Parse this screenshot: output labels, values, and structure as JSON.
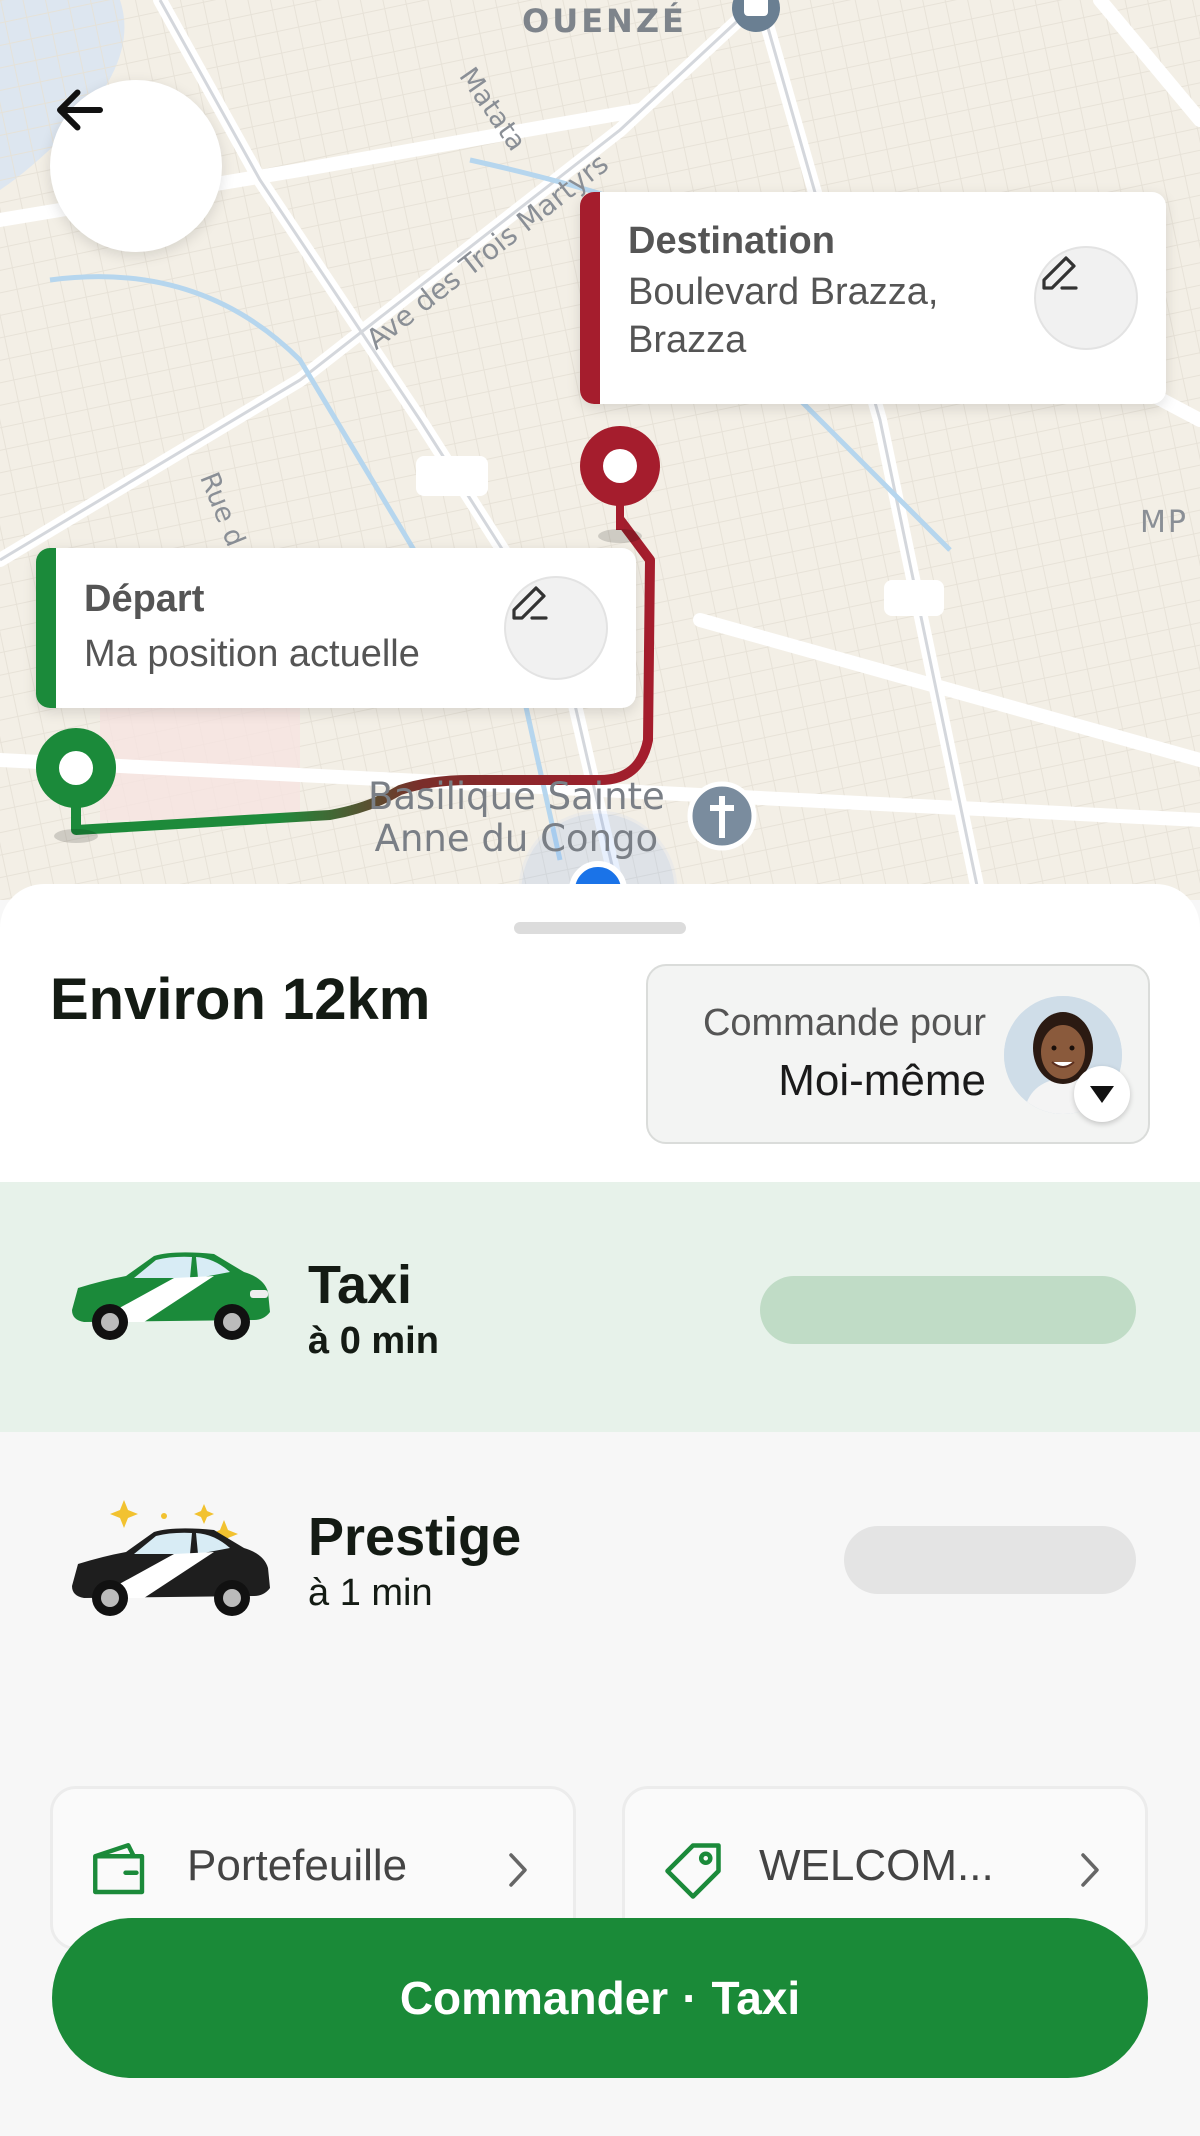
{
  "map": {
    "labels": {
      "ouenze": "OUENZÉ",
      "matata": "Matata",
      "ave_trois_martyrs": "Ave des Trois Martyrs",
      "rue": "Rue d",
      "mp": "MP",
      "basilique_line1": "Basilique Sainte",
      "basilique_line2": "Anne du Congo"
    },
    "route_colors": {
      "start": "#1b8a3a",
      "end": "#a51d2d"
    }
  },
  "back_button": {
    "icon": "arrow-left-icon"
  },
  "destination": {
    "title": "Destination",
    "address": "Boulevard Brazza, Brazza",
    "accent": "#a51d2d",
    "edit_icon": "pencil-icon"
  },
  "departure": {
    "title": "Départ",
    "address": "Ma position actuelle",
    "accent": "#1b8a3a",
    "edit_icon": "pencil-icon"
  },
  "sheet": {
    "distance": "Environ 12km",
    "order_for": {
      "label": "Commande pour",
      "value": "Moi-même"
    }
  },
  "rides": [
    {
      "name": "Taxi",
      "eta": "à 0 min",
      "selected": true,
      "car_color": "#1b8a3a"
    },
    {
      "name": "Prestige",
      "eta": "à 1 min",
      "selected": false,
      "car_color": "#1a1a1a"
    }
  ],
  "payment": {
    "label": "Portefeuille",
    "icon": "wallet-icon"
  },
  "promo": {
    "label": "WELCOM...",
    "icon": "tag-icon"
  },
  "cta": {
    "prefix": "Commander",
    "separator": "·",
    "ride": "Taxi",
    "color": "#1a8a38"
  }
}
